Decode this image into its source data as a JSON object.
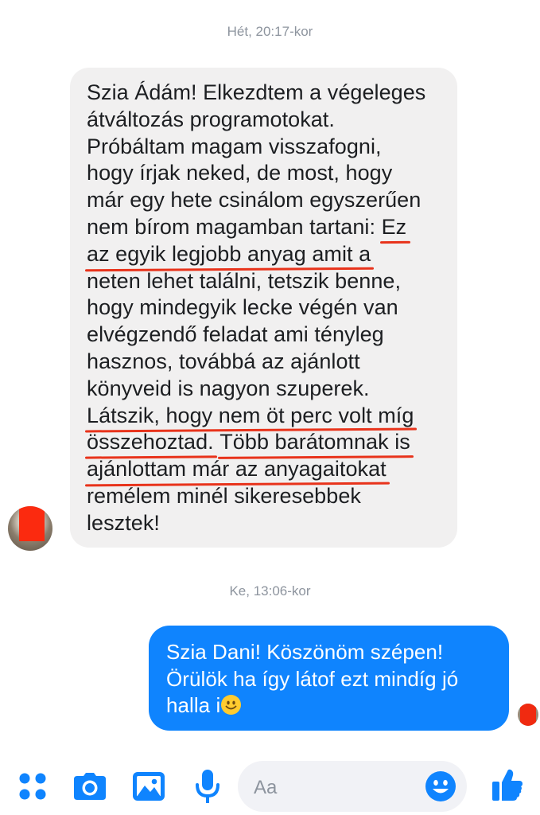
{
  "conversation": {
    "timestamp_1": "Hét, 20:17-kor",
    "incoming_message": {
      "lines": [
        "Szia Ádám! Elkezdtem a végeleges",
        "átváltozás programotokat.",
        "Próbáltam magam visszafogni,",
        "hogy írjak neked, de most, hogy",
        "már egy hete csinálom egyszerűen",
        "nem bírom magamban tartani: ",
        "Ez",
        "az egyik legjobb anyag amit a",
        "neten lehet találni, tetszik benne,",
        "hogy mindegyik lecke végén van",
        "elvégzendő feladat ami tényleg",
        "hasznos, továbbá az ajánlott",
        "könyveid is nagyon szuperek.",
        "Látszik, hogy nem öt perc volt míg",
        "összehoztad.",
        " ",
        "Több barátomnak is",
        "ajánlottam már az anyagaitokat",
        "remélem minél sikeresebbek",
        "lesztek!"
      ]
    },
    "timestamp_2": "Ke, 13:06-kor",
    "outgoing_message": {
      "lines": [
        "Szia Dani! Köszönöm szépen!",
        "Örülök ha így látof ezt mindíg jó",
        "halla i"
      ],
      "emoji": "smiling-face-emoji"
    },
    "highlight_color": "#e8331b"
  },
  "composer": {
    "placeholder": "Aa",
    "accent_color": "#0f84fe",
    "icons": [
      "more-actions-icon",
      "camera-icon",
      "gallery-icon",
      "microphone-icon",
      "emoji-icon",
      "thumbs-up-icon"
    ]
  },
  "colors": {
    "incoming_bubble": "#f1f0f0",
    "outgoing_bubble": "#0f84fe",
    "timestamp": "#8d949e",
    "redaction": "#fb2a0f"
  }
}
